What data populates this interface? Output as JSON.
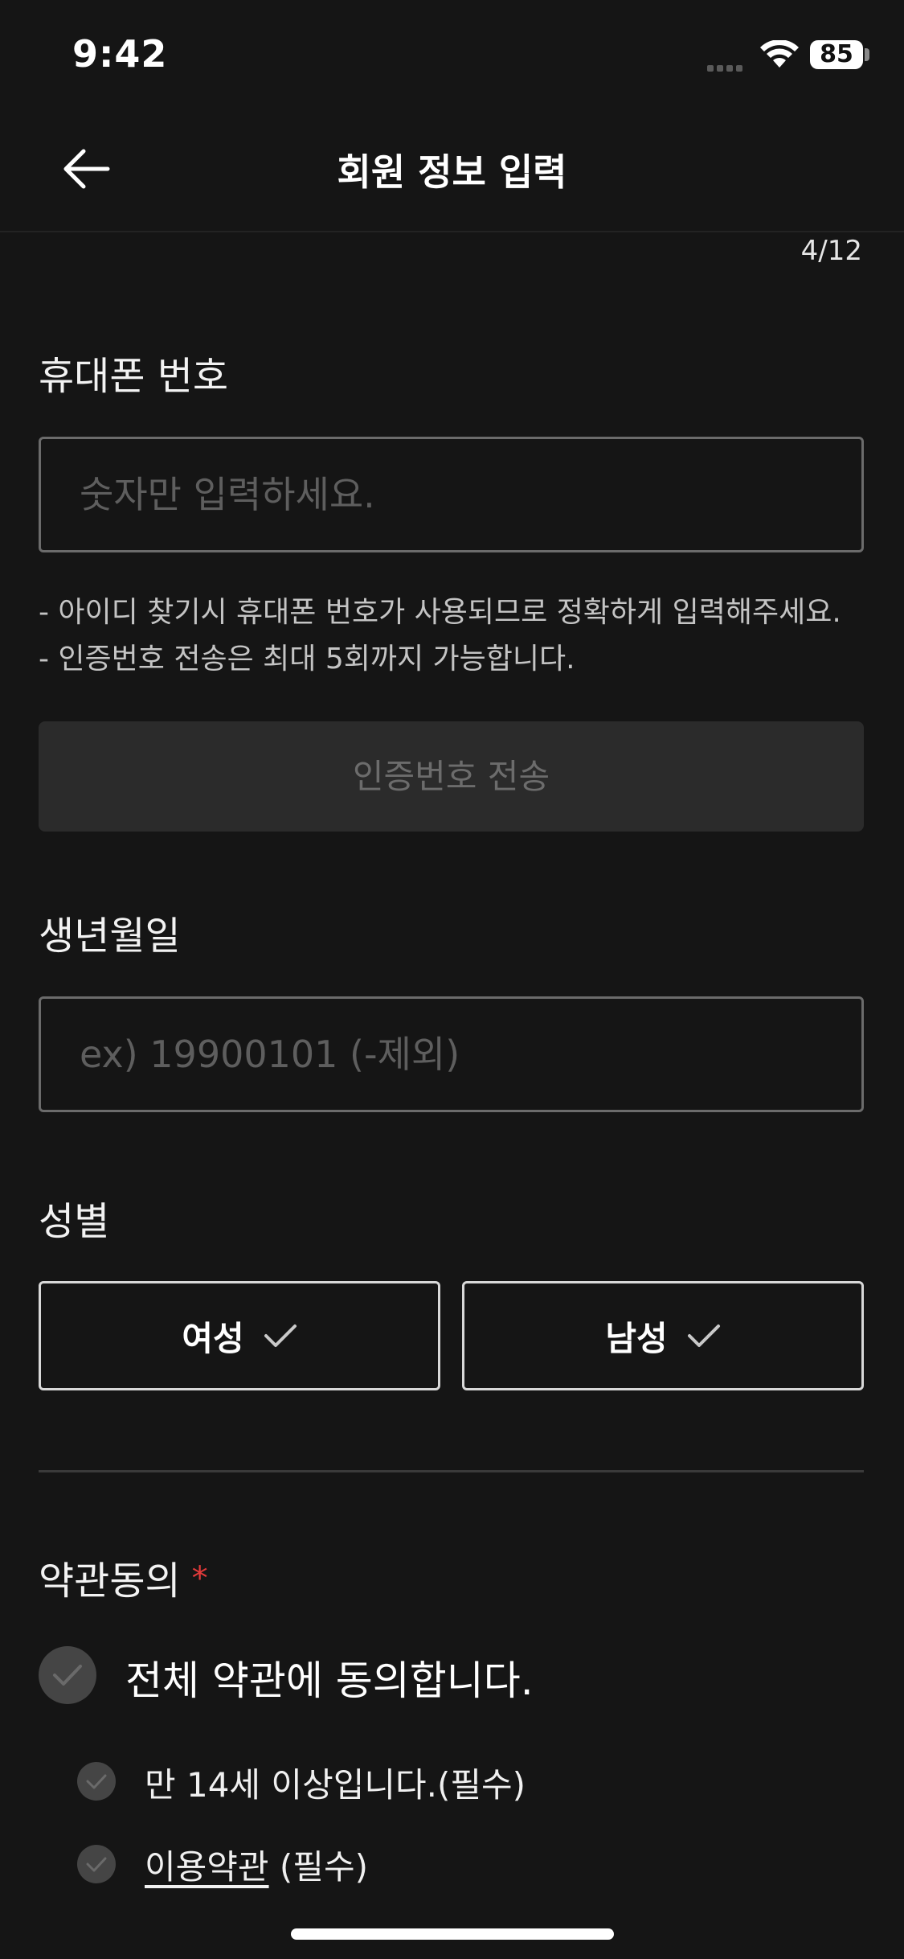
{
  "status_bar": {
    "time": "9:42",
    "battery": "85"
  },
  "nav": {
    "title": "회원 정보 입력",
    "step": "4/12",
    "back_icon": "arrow-left-icon"
  },
  "phone": {
    "label": "휴대폰 번호",
    "placeholder": "숫자만 입력하세요.",
    "help_1": "- 아이디 찾기시 휴대폰 번호가 사용되므로 정확하게 입력해주세요.",
    "help_2": "- 인증번호 전송은 최대 5회까지 가능합니다.",
    "send_button": "인증번호 전송"
  },
  "birth": {
    "label": "생년월일",
    "placeholder": "ex) 19900101 (-제외)"
  },
  "gender": {
    "label": "성별",
    "female": "여성",
    "male": "남성"
  },
  "terms": {
    "label": "약관동의",
    "required_mark": "*",
    "all_agree": "전체 약관에 동의합니다.",
    "item_1": "만 14세 이상입니다.(필수)",
    "item_2_link": "이용약관",
    "item_2_suffix": " (필수)"
  },
  "colors": {
    "background": "#151515",
    "required": "#e23a3a",
    "disabled_button": "#2b2b2b"
  }
}
